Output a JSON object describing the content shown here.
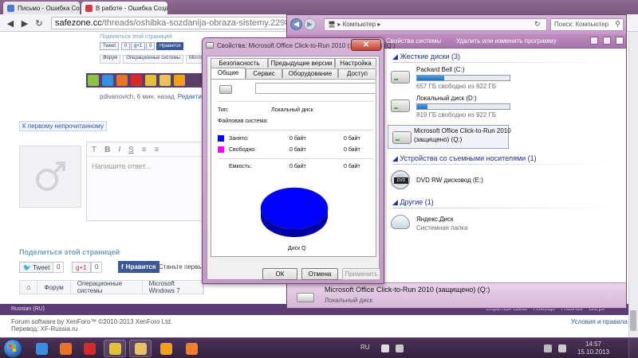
{
  "browser": {
    "tabs": [
      {
        "title": "Письмо - Ошибка Соз..."
      },
      {
        "title": "В работе - Ошибка Созд..."
      }
    ],
    "url_host": "safezone.cc",
    "url_path": "/threads/oshibka-sozdanija-obraza-sistemy.2298"
  },
  "page": {
    "mini_share_title": "Поделиться этой страницей",
    "mini_buttons": [
      "Tweet",
      "0",
      "g+1",
      "0",
      "Нравится"
    ],
    "mini_crumbs": [
      "Форум",
      "Операционные системы",
      "Microsoft Windows 7"
    ],
    "author": "pdivanovich, 6 мин. назад",
    "edit_link": "Редактировать",
    "unread_link": "К первому непрочитанному",
    "editor_tools": [
      "T",
      "B",
      "I",
      "S",
      "≡",
      "≡"
    ],
    "editor_placeholder": "Напишите ответ...",
    "share_title": "Поделиться этой страницей",
    "tweet_label": "Tweet",
    "tweet_count": "0",
    "gplus_label": "g+1",
    "gplus_count": "0",
    "vk_label": "Нравится",
    "vk_text": "Станьте первым...",
    "breadcrumb": [
      "Форум",
      "Операционные системы",
      "Microsoft Windows 7"
    ],
    "language": "Russian (RU)",
    "footer_links": [
      "Обратная связь",
      "Помощь",
      "Главная",
      "Вверх"
    ],
    "footer_copyright": "Forum software by XenForo™ ©2010-2013 XenForo Ltd.",
    "footer_translation": "Перевод: XF-Russia.ru",
    "terms_link": "Условия и правила"
  },
  "explorer": {
    "address": "▸ Компьютер ▸",
    "search_placeholder": "Поиск: Компьютер",
    "commands": [
      "Свойства системы",
      "Удалить или изменить программу"
    ],
    "groups": {
      "hard_drives": "Жесткие диски (3)",
      "removable": "Устройства со съемными носителями (1)",
      "other": "Другие (1)"
    },
    "drives": [
      {
        "name": "Packard Bell (C:)",
        "free": "657 ГБ свободно из 922 ГБ",
        "used_fraction": 0.29
      },
      {
        "name": "Локальный диск (D:)",
        "free": "819 ГБ свободно из 922 ГБ",
        "used_fraction": 0.11
      },
      {
        "name": "Microsoft Office Click-to-Run 2010",
        "name2": "(защищено) (Q:)"
      }
    ],
    "dvd": {
      "name": "DVD RW дисковод (E:)",
      "icon_label": "DVD"
    },
    "cloud": {
      "name": "Яндекс.Диск",
      "type": "Системная папка"
    },
    "details": {
      "name": "Microsoft Office Click-to-Run 2010 (защищено) (Q:)",
      "type": "Локальный диск"
    }
  },
  "dialog": {
    "title": "Свойства: Microsoft Office Click-to-Run 2010 (защищено) (Q:)",
    "tabs_row1": [
      "Безопасность",
      "Предыдущие версии",
      "Настройка"
    ],
    "tabs_row2": [
      "Общие",
      "Сервис",
      "Оборудование",
      "Доступ"
    ],
    "type_label": "Тип:",
    "type_value": "Локальный диск",
    "fs_label": "Файловая система:",
    "used_label": "Занято:",
    "used_bytes": "0 байт",
    "used_size": "0 байт",
    "free_label": "Свободно:",
    "free_bytes": "0 байт",
    "free_size": "0 байт",
    "capacity_label": "Емкость:",
    "capacity_bytes": "0 байт",
    "capacity_size": "0 байт",
    "disk_label": "Диск Q",
    "ok": "ОК",
    "cancel": "Отмена",
    "apply": "Применить",
    "colors": {
      "used": "#0000ff",
      "free": "#ff00ff"
    }
  },
  "taskbar": {
    "lang": "RU",
    "clock_time": "14:57",
    "clock_date": "15.10.2013",
    "items": [
      {
        "icon": "ie-icon",
        "color": "#3a8fe0"
      },
      {
        "icon": "firefox-icon",
        "color": "#e8742a"
      },
      {
        "icon": "yandex-icon",
        "color": "#d62a2a"
      },
      {
        "icon": "chrome-icon",
        "color": "#e2c23a"
      },
      {
        "icon": "explorer-icon",
        "color": "#e9c265"
      },
      {
        "icon": "media-icon",
        "color": "#f0a01e"
      },
      {
        "icon": "paint-icon",
        "color": "#ee7f2b"
      }
    ]
  }
}
